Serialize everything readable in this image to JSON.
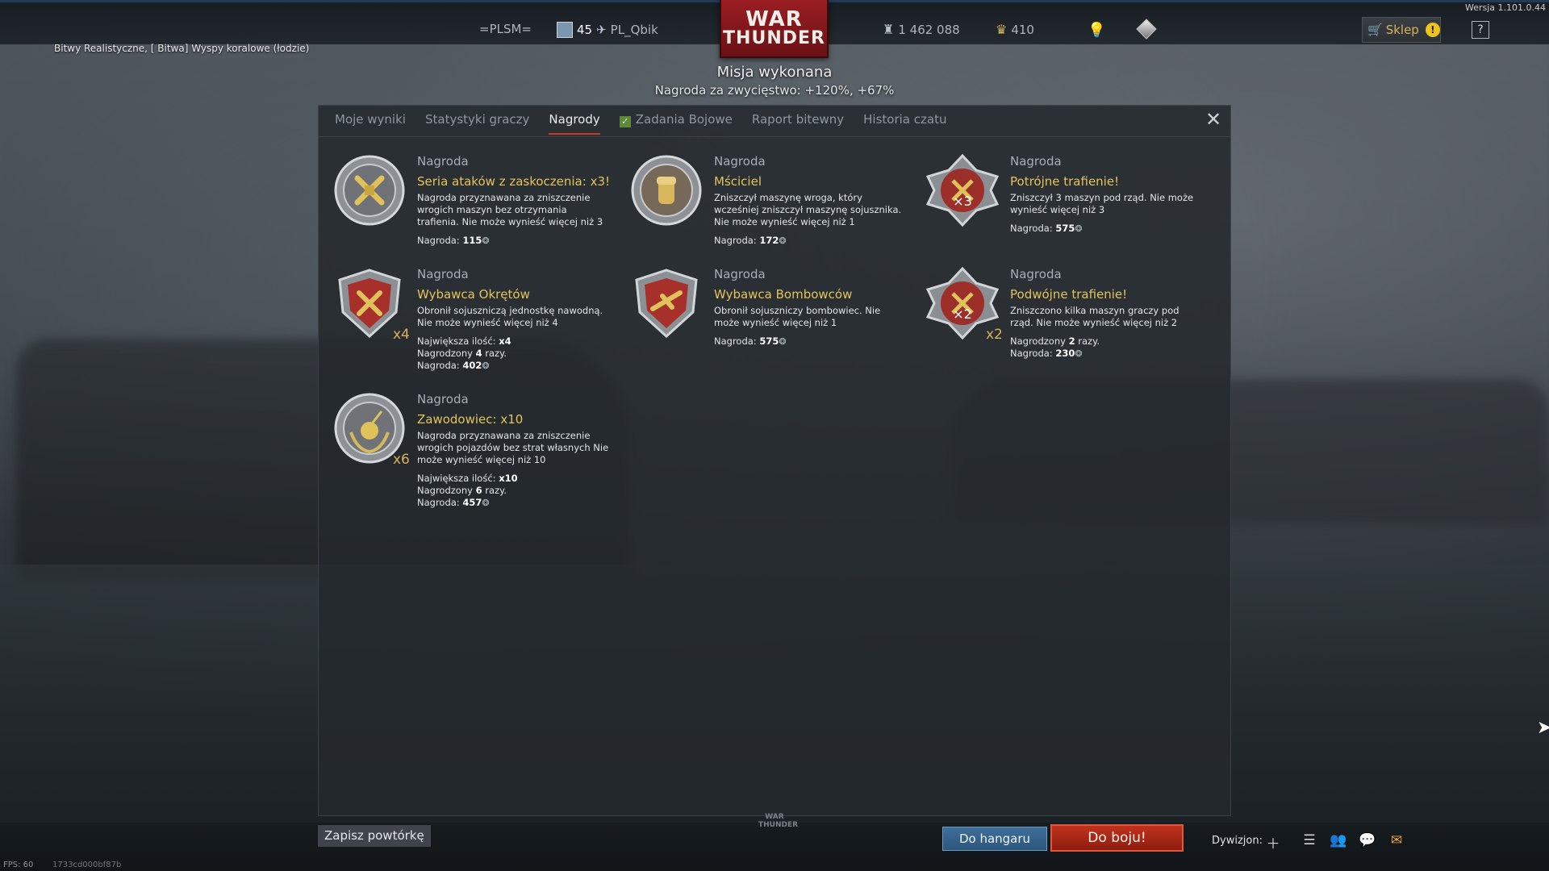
{
  "version": "Wersja 1.101.0.44",
  "topbar": {
    "squad_tag": "=PLSM=",
    "level": "45",
    "player_name": "PL_Qbik",
    "logo_line1": "WAR",
    "logo_line2": "THUNDER",
    "silver_lions": "1 462 088",
    "golden_eagles": "410",
    "shop_label": "Sklep",
    "help_label": "?"
  },
  "battle_info": "Bitwy Realistyczne, [ Bitwa] Wyspy koralowe (łodzie)",
  "mission": {
    "title": "Misja wykonana",
    "reward": "Nagroda za zwycięstwo: +120%, +67%"
  },
  "tabs": [
    {
      "label": "Moje wyniki"
    },
    {
      "label": "Statystyki graczy"
    },
    {
      "label": "Nagrody"
    },
    {
      "label": "Zadania Bojowe"
    },
    {
      "label": "Raport bitewny"
    },
    {
      "label": "Historia czatu"
    }
  ],
  "awards": [
    {
      "kind": "Nagroda",
      "name": "Seria ataków z zaskoczenia: x3!",
      "desc": "Nagroda przyznawana za zniszczenie wrogich maszyn bez otrzymania trafienia. Nie może wynieść więcej niż 3",
      "reward_label": "Nagroda:",
      "reward_value": "115",
      "icon": "surprise-attack-medal-icon",
      "multiplier": ""
    },
    {
      "kind": "Nagroda",
      "name": "Mściciel",
      "desc": "Zniszczył maszynę wroga, który wcześniej zniszczył maszynę sojusznika. Nie może wynieść więcej niż 1",
      "reward_label": "Nagroda:",
      "reward_value": "172",
      "icon": "avenger-medal-icon",
      "multiplier": ""
    },
    {
      "kind": "Nagroda",
      "name": "Potrójne trafienie!",
      "desc": "Zniszczył 3 maszyn pod rząd. Nie może wynieść więcej niż 3",
      "reward_label": "Nagroda:",
      "reward_value": "575",
      "icon": "triple-strike-badge-icon",
      "multiplier": ""
    },
    {
      "kind": "Nagroda",
      "name": "Wybawca Okrętów",
      "desc": "Obronił sojuszniczą jednostkę nawodną. Nie może wynieść więcej niż 4",
      "max_label": "Największa ilość:",
      "max_value": "x4",
      "times_pre": "Nagrodzony",
      "times_value": "4",
      "times_post": "razy.",
      "reward_label": "Nagroda:",
      "reward_value": "402",
      "icon": "ship-savior-shield-icon",
      "multiplier": "x4"
    },
    {
      "kind": "Nagroda",
      "name": "Wybawca Bombowców",
      "desc": "Obronił sojuszniczy bombowiec. Nie może wynieść więcej niż 1",
      "reward_label": "Nagroda:",
      "reward_value": "575",
      "icon": "bomber-savior-shield-icon",
      "multiplier": ""
    },
    {
      "kind": "Nagroda",
      "name": "Podwójne trafienie!",
      "desc": "Zniszczono kilka maszyn graczy pod rząd. Nie może wynieść więcej niż 2",
      "times_pre": "Nagrodzony",
      "times_value": "2",
      "times_post": "razy.",
      "reward_label": "Nagroda:",
      "reward_value": "230",
      "icon": "double-strike-badge-icon",
      "multiplier": "x2"
    },
    {
      "kind": "Nagroda",
      "name": "Zawodowiec: x10",
      "desc": "Nagroda przyznawana za zniszczenie wrogich pojazdów bez strat własnych Nie może wynieść więcej niż 10",
      "max_label": "Największa ilość:",
      "max_value": "x10",
      "times_pre": "Nagrodzony",
      "times_value": "6",
      "times_post": "razy.",
      "reward_label": "Nagroda:",
      "reward_value": "457",
      "icon": "professional-medal-icon",
      "multiplier": "x6"
    }
  ],
  "bottombar": {
    "save_replay": "Zapisz powtórkę",
    "small_logo_line1": "WAR",
    "small_logo_line2": "THUNDER",
    "to_hangar": "Do hangaru",
    "to_battle": "Do boju!",
    "squadron": "Dywizjon:",
    "fps": "FPS: 60",
    "hash": "1733cd000bf87b"
  },
  "colors": {
    "accent_gold": "#e4c35a",
    "tab_underline": "#c63c24",
    "battle_button": "#c0321c",
    "hangar_button": "#3f6f9a"
  }
}
